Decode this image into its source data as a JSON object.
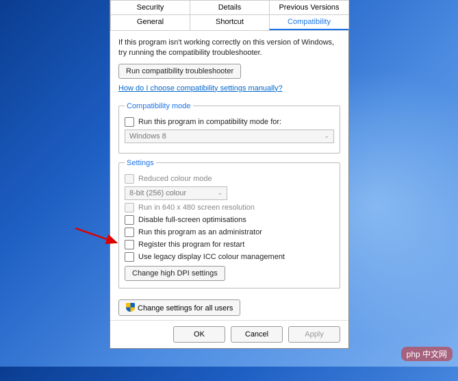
{
  "tabs": {
    "row1": [
      "Security",
      "Details",
      "Previous Versions"
    ],
    "row2": [
      "General",
      "Shortcut",
      "Compatibility"
    ],
    "active": "Compatibility"
  },
  "intro": "If this program isn't working correctly on this version of Windows, try running the compatibility troubleshooter.",
  "buttons": {
    "troubleshooter": "Run compatibility troubleshooter",
    "help_link": "How do I choose compatibility settings manually?",
    "dpi": "Change high DPI settings",
    "all_users": "Change settings for all users",
    "ok": "OK",
    "cancel": "Cancel",
    "apply": "Apply"
  },
  "compat_mode": {
    "legend": "Compatibility mode",
    "checkbox": "Run this program in compatibility mode for:",
    "select_value": "Windows 8"
  },
  "settings": {
    "legend": "Settings",
    "reduced_color": "Reduced colour mode",
    "color_select": "8-bit (256) colour",
    "lowres": "Run in 640 x 480 screen resolution",
    "disable_fullscreen": "Disable full-screen optimisations",
    "admin": "Run this program as an administrator",
    "restart": "Register this program for restart",
    "icc": "Use legacy display ICC colour management"
  },
  "watermark": "php 中文网"
}
